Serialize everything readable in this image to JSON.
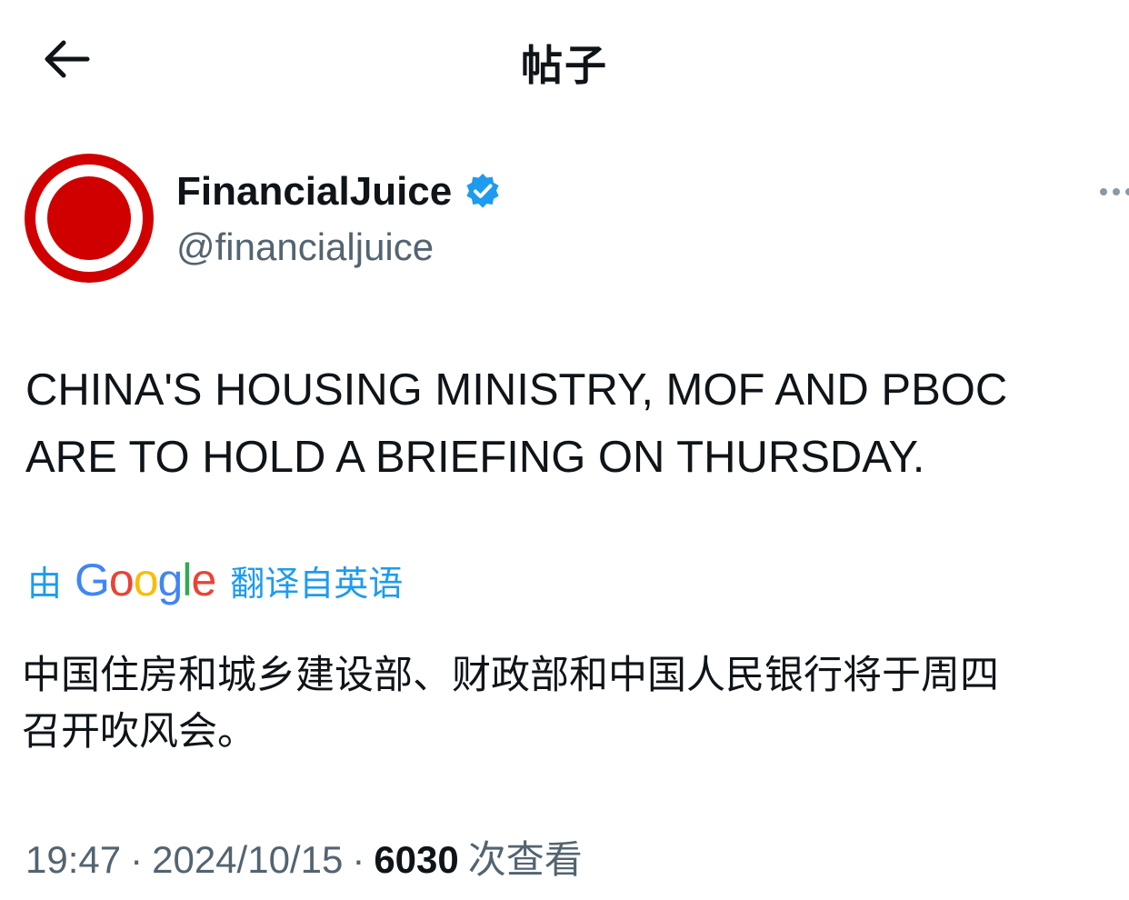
{
  "header": {
    "title": "帖子",
    "back_icon": "arrow-left-icon"
  },
  "author": {
    "display_name": "FinancialJuice",
    "handle": "@financialjuice",
    "verified_icon": "verified-badge-icon",
    "avatar_colors": {
      "outer": "#d10000",
      "ring": "#ffffff",
      "inner": "#d10000"
    }
  },
  "more_icon": "more-options-icon",
  "post": {
    "text_line1": "CHINA'S HOUSING MINISTRY, MOF AND PBOC",
    "text_line2": "ARE TO HOLD A BRIEFING ON THURSDAY.",
    "translation": {
      "prefix": "由",
      "provider": "Google",
      "suffix": "翻译自英语",
      "text_line1": "中国住房和城乡建设部、财政部和中国人民银行将于周四",
      "text_line2": "召开吹风会。"
    }
  },
  "meta": {
    "time": "19:47",
    "separator": "·",
    "date": "2024/10/15",
    "views_count": "6030",
    "views_label": "次查看"
  },
  "colors": {
    "link": "#1d9bf0",
    "secondary_text": "#536471",
    "primary_text": "#0f1419",
    "google_blue": "#4285F4",
    "google_red": "#EA4335",
    "google_yellow": "#FBBC05",
    "google_green": "#34A853"
  }
}
